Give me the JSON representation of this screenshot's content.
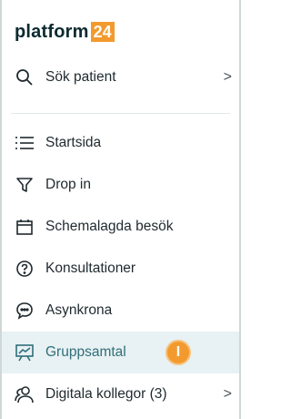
{
  "logo": {
    "text": "platform",
    "badge": "24"
  },
  "search": {
    "label": "Sök patient",
    "chevron": ">"
  },
  "nav": {
    "items": [
      {
        "label": "Startsida",
        "icon": "list-icon"
      },
      {
        "label": "Drop in",
        "icon": "funnel-icon"
      },
      {
        "label": "Schemalagda besök",
        "icon": "calendar-icon"
      },
      {
        "label": "Konsultationer",
        "icon": "question-circle-icon"
      },
      {
        "label": "Asynkrona",
        "icon": "chat-bubble-icon"
      },
      {
        "label": "Gruppsamtal",
        "icon": "presentation-icon",
        "active": true,
        "badge": "I"
      },
      {
        "label": "Digitala kollegor (3)",
        "icon": "users-icon",
        "chevron": ">"
      }
    ]
  },
  "colors": {
    "accent": "#f29a2e",
    "active_bg": "#e8f1f3",
    "text": "#1f2a2e"
  }
}
